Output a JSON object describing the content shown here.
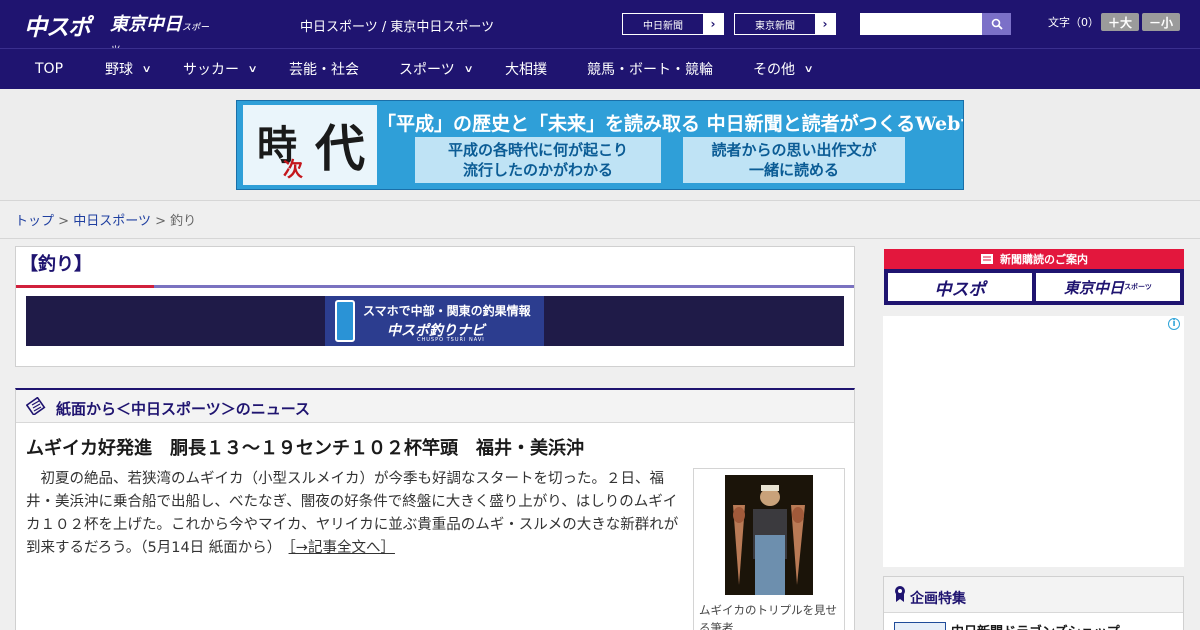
{
  "header": {
    "logo_chuspo": "中スポ",
    "logo_tokyo": "東京中日",
    "logo_tokyo_small": "スポーツ",
    "site_title": "中日スポーツ / 東京中日スポーツ",
    "paper_links": [
      "中日新聞",
      "東京新聞"
    ],
    "search_placeholder": "",
    "font_size_label": "文字（0）",
    "font_larger": "＋大",
    "font_smaller": "－小"
  },
  "nav": {
    "items": [
      {
        "label": "TOP",
        "has_menu": false
      },
      {
        "label": "野球",
        "has_menu": true
      },
      {
        "label": "サッカー",
        "has_menu": true
      },
      {
        "label": "芸能・社会",
        "has_menu": false
      },
      {
        "label": "スポーツ",
        "has_menu": true
      },
      {
        "label": "大相撲",
        "has_menu": false
      },
      {
        "label": "競馬・ボート・競輪",
        "has_menu": false
      },
      {
        "label": "その他",
        "has_menu": true
      }
    ]
  },
  "banner": {
    "logo_chars": [
      "時",
      "次",
      "代"
    ],
    "headline": "「平成」の歴史と「未来」を読み取る 中日新聞と読者がつくるWebサイト",
    "box1": [
      "平成の各時代に何が起こり",
      "流行したのかがわかる"
    ],
    "box2": [
      "読者からの思い出作文が",
      "一緒に読める"
    ]
  },
  "breadcrumb": {
    "items": [
      "トップ",
      "中日スポーツ",
      "釣り"
    ],
    "separator": ">"
  },
  "category": {
    "title": "【釣り】",
    "promo_line1": "スマホで中部・関東の釣果情報",
    "promo_line2": "中スポ釣りナビ",
    "promo_line3": "CHUSPO TSURI NAVI"
  },
  "news": {
    "section_title": "紙面から＜中日スポーツ＞のニュース",
    "article_title": "ムギイカ好発進　胴長１３～１９センチ１０２杯竿頭　福井・美浜沖",
    "article_body": "　初夏の絶品、若狭湾のムギイカ（小型スルメイカ）が今季も好調なスタートを切った。２日、福井・美浜沖に乗合船で出船し、べたなぎ、闇夜の好条件で終盤に大きく盛り上がり、はしりのムギイカ１０２杯を上げた。これから今やマイカ、ヤリイカに並ぶ貴重品のムギ・スルメの大きな新群れが到来するだろう。（5月14日 紙面から）",
    "read_more": "［→記事全文へ］",
    "photo_caption": "ムギイカのトリプルを見せる筆者"
  },
  "sidebar": {
    "subscribe_label": "新聞購読のご案内",
    "subscribe_buttons": [
      "中スポ",
      "東京中日"
    ],
    "subscribe_small": "スポーツ",
    "ad_info": "i",
    "feature_title": "企画特集",
    "feature_item": "中日新聞ドラゴンズショップ"
  },
  "colors": {
    "brand_navy": "#1f1470",
    "accent_red": "#d1203c",
    "accent_purple": "#7a72c0",
    "link_blue": "#1f3fa0"
  }
}
